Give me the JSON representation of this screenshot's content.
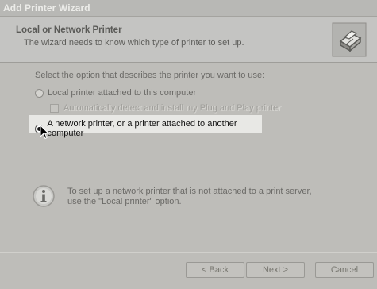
{
  "window": {
    "title": "Add Printer Wizard"
  },
  "header": {
    "title": "Local or Network Printer",
    "subtitle": "The wizard needs to know which type of printer to set up.",
    "icon": "printer-icon"
  },
  "content": {
    "instruction": "Select the option that describes the printer you want to use:",
    "options": [
      {
        "label": "Local printer attached to this computer",
        "selected": false
      },
      {
        "label": "A network printer, or a printer attached to another computer",
        "selected": true
      }
    ],
    "auto_detect": {
      "label": "Automatically detect and install my Plug and Play printer",
      "checked": false,
      "enabled": false
    },
    "info_lines": [
      "To set up a network printer that is not attached to a print server,",
      "use the \"Local printer\" option."
    ]
  },
  "buttons": {
    "back": "< Back",
    "next": "Next >",
    "cancel": "Cancel"
  }
}
